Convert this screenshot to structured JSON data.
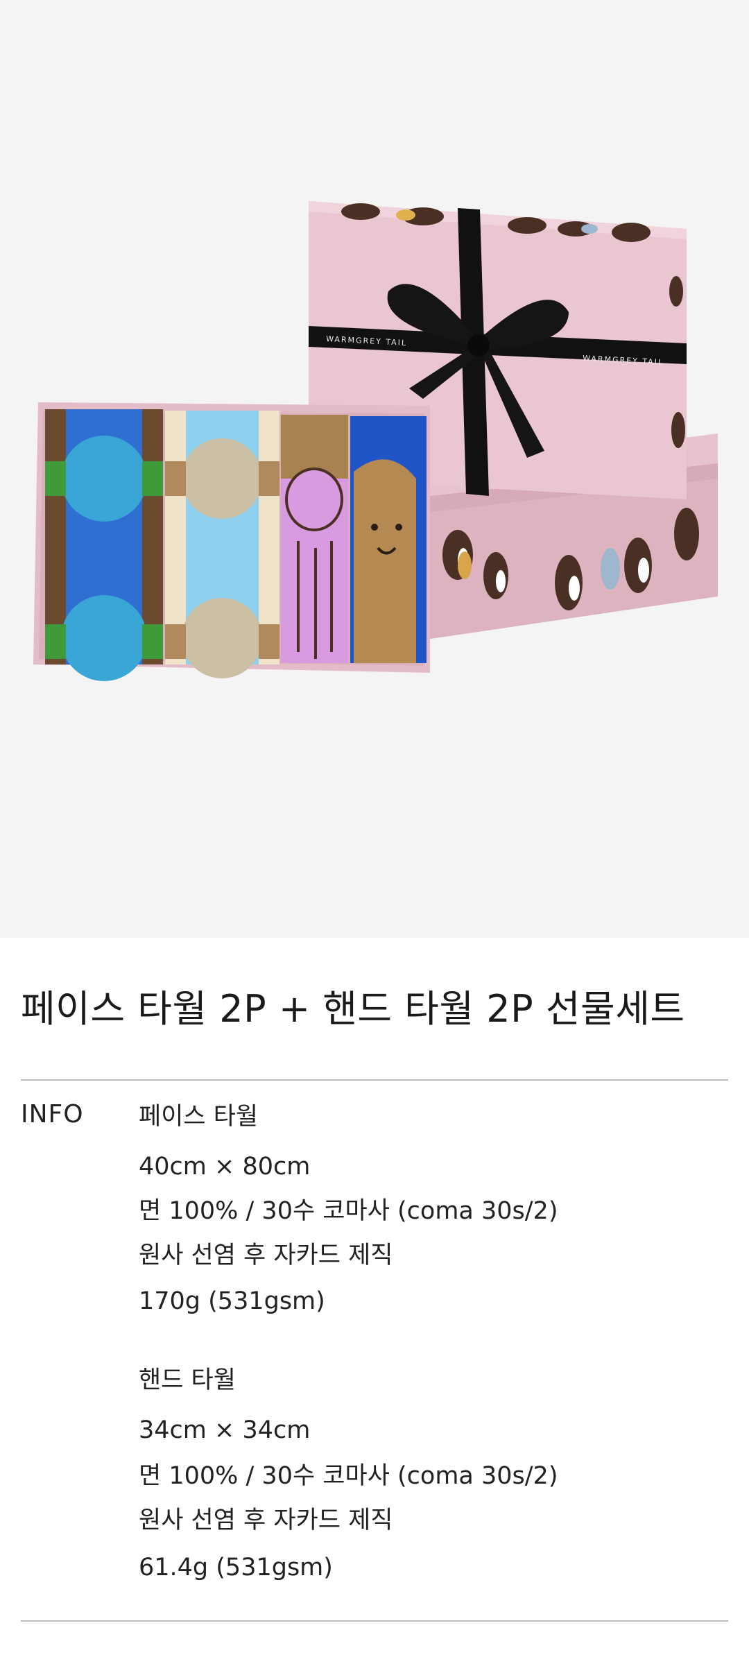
{
  "product": {
    "title": "페이스 타월 2P + 핸드 타월 2P 선물세트",
    "info_label": "INFO",
    "face_towel": {
      "name": "페이스 타월",
      "size": "40cm × 80cm",
      "material": "면 100% / 30수 코마사 (coma 30s/2)",
      "process": "원사 선염 후 자카드 제직",
      "weight": "170g (531gsm)"
    },
    "hand_towel": {
      "name": "핸드 타월",
      "size": "34cm × 34cm",
      "material": "면 100% / 30수 코마사 (coma 30s/2)",
      "process": "원사 선염 후 자카드 제직",
      "weight": "61.4g (531gsm)"
    }
  },
  "image": {
    "ribbon_text": "WARMGREY TAIL"
  },
  "colors": {
    "hero_bg": "#f4f4f4",
    "box_pink": "#e9c6d0",
    "ribbon": "#111111",
    "divider": "#bdbdbd"
  }
}
